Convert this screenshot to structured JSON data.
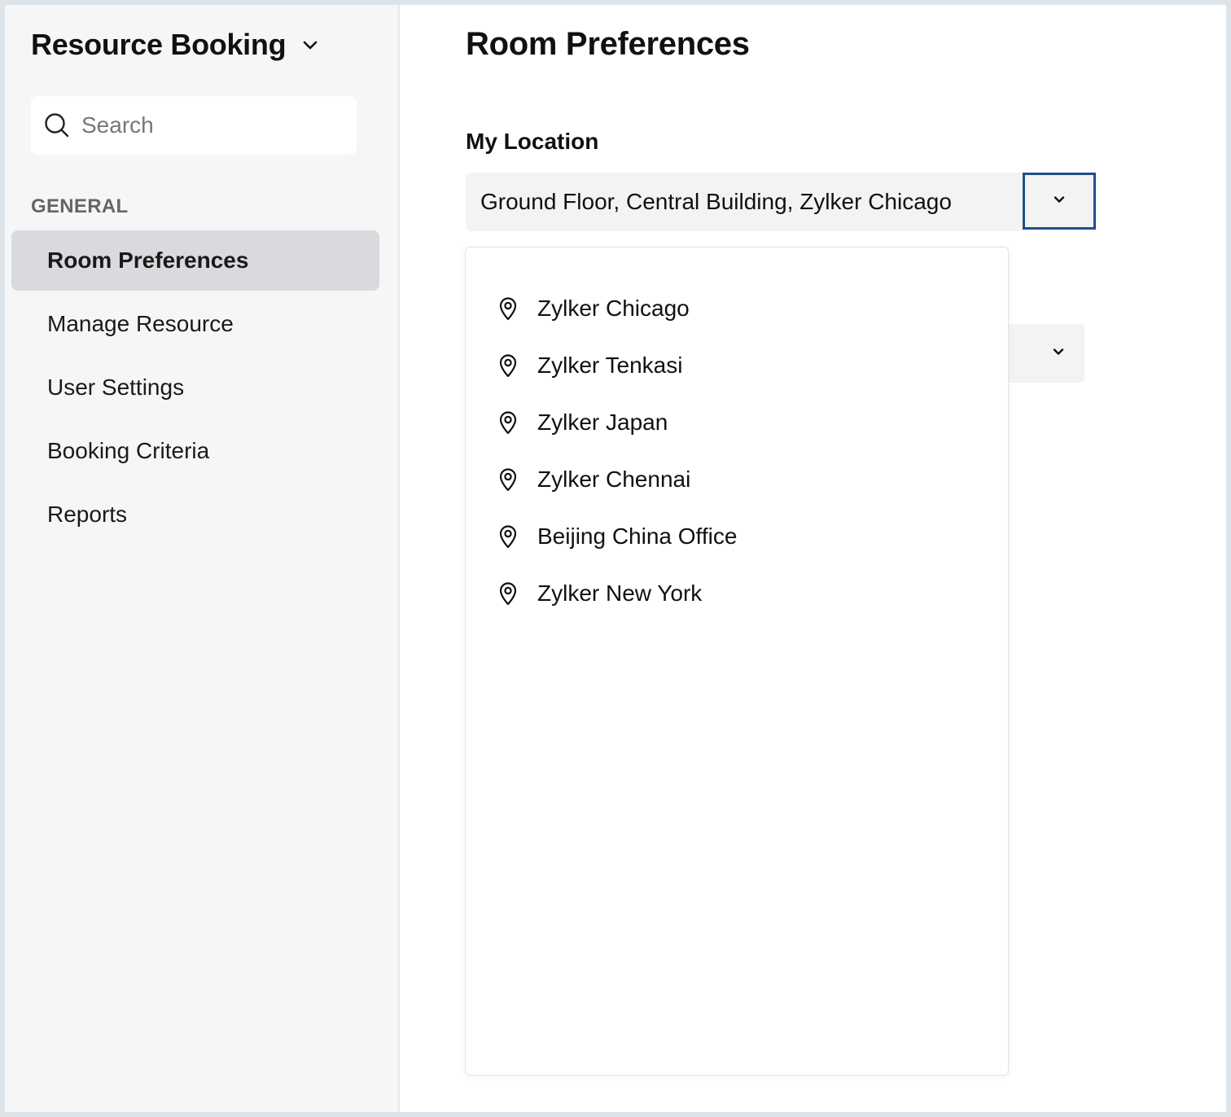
{
  "sidebar": {
    "app_title": "Resource Booking",
    "search": {
      "placeholder": "Search",
      "value": ""
    },
    "section_label": "GENERAL",
    "items": [
      {
        "label": "Room Preferences",
        "active": true
      },
      {
        "label": "Manage Resource",
        "active": false
      },
      {
        "label": "User Settings",
        "active": false
      },
      {
        "label": "Booking Criteria",
        "active": false
      },
      {
        "label": "Reports",
        "active": false
      }
    ]
  },
  "main": {
    "title": "Room Preferences",
    "my_location": {
      "label": "My Location",
      "selected": "Ground Floor, Central Building, Zylker Chicago",
      "options": [
        "Zylker Chicago",
        "Zylker Tenkasi",
        "Zylker Japan",
        "Zylker Chennai",
        "Beijing China Office",
        "Zylker New York"
      ]
    }
  },
  "colors": {
    "focus_border": "#1f4e8c",
    "sidebar_bg": "#f6f6f6",
    "active_item_bg": "#d9dadd"
  },
  "icons": {
    "app_menu": "chevron-down-icon",
    "search": "search-icon",
    "dropdown_toggle": "chevron-down-icon",
    "option": "location-pin-icon"
  }
}
